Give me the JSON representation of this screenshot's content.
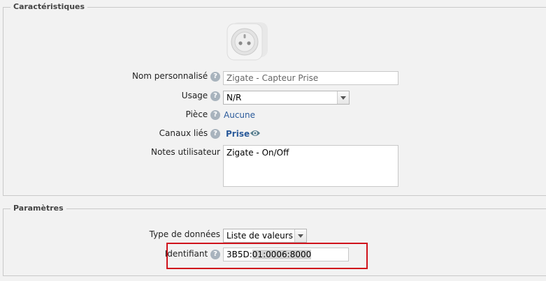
{
  "characteristics": {
    "legend": "Caractéristiques",
    "device_icon": "french-socket-plug-icon",
    "fields": {
      "name": {
        "label": "Nom personnalisé",
        "value": "Zigate - Capteur Prise"
      },
      "usage": {
        "label": "Usage",
        "value": "N/R"
      },
      "room": {
        "label": "Pièce",
        "value": "Aucune"
      },
      "channels": {
        "label": "Canaux liés",
        "value": "Prise"
      },
      "notes": {
        "label": "Notes utilisateur",
        "value": "Zigate - On/Off"
      }
    },
    "help_glyph": "?"
  },
  "parameters": {
    "legend": "Paramètres",
    "fields": {
      "data_type": {
        "label": "Type de données",
        "value": "Liste de valeurs"
      },
      "identifier": {
        "label": "Identifiant",
        "value_plain": "3B5D:",
        "value_selected": "01:0006:8000"
      }
    }
  },
  "colors": {
    "highlight_box": "#d0121b",
    "link": "#2a5a9a",
    "help": "#a8b3bd"
  }
}
